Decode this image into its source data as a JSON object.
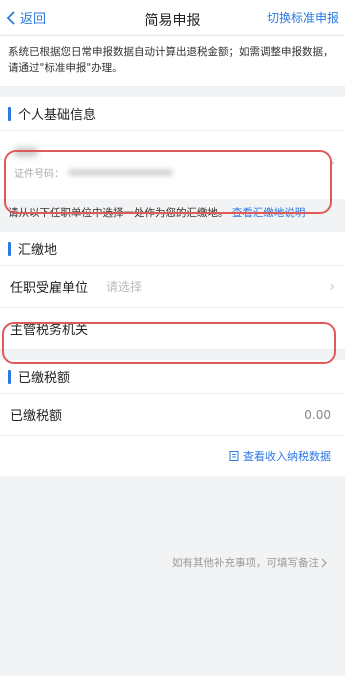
{
  "nav": {
    "back_label": "返回",
    "title": "简易申报",
    "right_action": "切换标准申报"
  },
  "notice": {
    "text": "系统已根据您日常申报数据自动计算出退税金额；如需调整申报数据，请通过\"标准申报\"办理。"
  },
  "personal": {
    "section_title": "个人基础信息",
    "id_label": "证件号码："
  },
  "helper": {
    "text": "请从以下任职单位中选择一处作为您的汇缴地。",
    "link": "查看汇缴地说明"
  },
  "remit": {
    "section_title": "汇缴地",
    "employer_label": "任职受雇单位",
    "employer_placeholder": "请选择",
    "tax_office_label": "主管税务机关"
  },
  "paid": {
    "section_title": "已缴税额",
    "row_label": "已缴税额",
    "row_value": "0.00",
    "link": "查看收入纳税数据"
  },
  "footer": {
    "note": "如有其他补充事项，可填写备注"
  },
  "colors": {
    "accent": "#2b79e3",
    "highlight_outline": "#e05a5a"
  }
}
